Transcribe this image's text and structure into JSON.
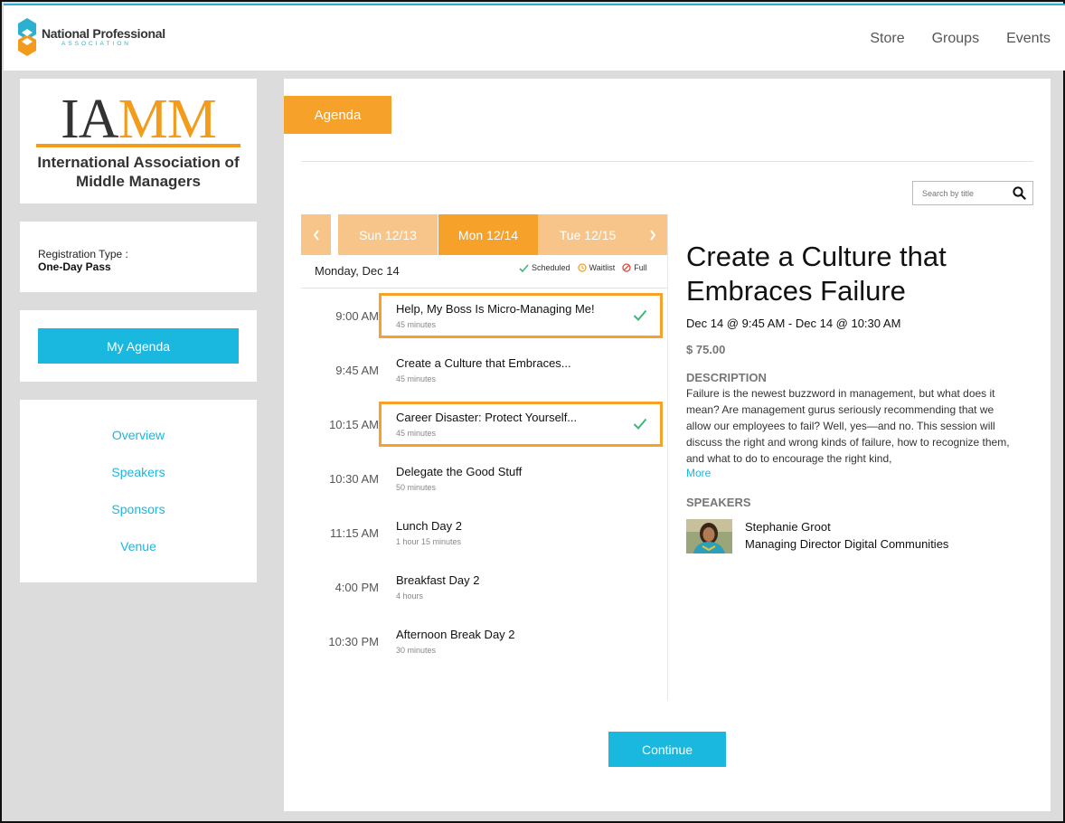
{
  "header": {
    "org_name": "National Professional",
    "org_sub": "ASSOCIATION",
    "nav": [
      {
        "label": "Store"
      },
      {
        "label": "Groups"
      },
      {
        "label": "Events"
      }
    ]
  },
  "sidebar": {
    "logo_word": "IAMM",
    "logo_name": "International Association of Middle Managers",
    "registration_label": "Registration Type :",
    "registration_value": "One-Day Pass",
    "my_agenda_button": "My Agenda",
    "links": [
      {
        "label": "Overview"
      },
      {
        "label": "Speakers"
      },
      {
        "label": "Sponsors"
      },
      {
        "label": "Venue"
      }
    ]
  },
  "main": {
    "tab_label": "Agenda",
    "search_placeholder": "Search by title",
    "days": [
      {
        "label": "Sun 12/13",
        "active": false
      },
      {
        "label": "Mon 12/14",
        "active": true
      },
      {
        "label": "Tue 12/15",
        "active": false
      }
    ],
    "day_heading": "Monday, Dec 14",
    "legend": {
      "scheduled": "Scheduled",
      "waitlist": "Waitlist",
      "full": "Full"
    },
    "sessions": [
      {
        "time": "9:00 AM",
        "title": "Help, My Boss Is Micro-Managing Me!",
        "duration": "45 minutes",
        "scheduled": true
      },
      {
        "time": "9:45 AM",
        "title": "Create a Culture that Embraces...",
        "duration": "45 minutes",
        "scheduled": false
      },
      {
        "time": "10:15 AM",
        "title": "Career Disaster: Protect Yourself...",
        "duration": "45 minutes",
        "scheduled": true
      },
      {
        "time": "10:30 AM",
        "title": "Delegate the Good Stuff",
        "duration": "50 minutes",
        "scheduled": false
      },
      {
        "time": "11:15 AM",
        "title": "Lunch Day 2",
        "duration": "1 hour 15 minutes",
        "scheduled": false
      },
      {
        "time": "4:00 PM",
        "title": "Breakfast Day 2",
        "duration": "4 hours",
        "scheduled": false
      },
      {
        "time": "10:30 PM",
        "title": "Afternoon Break Day 2",
        "duration": "30 minutes",
        "scheduled": false
      }
    ],
    "detail": {
      "title": "Create a Culture that Embraces Failure",
      "time": "Dec 14 @ 9:45 AM - Dec 14 @ 10:30 AM",
      "price": "$ 75.00",
      "description_label": "DESCRIPTION",
      "description": "Failure is the newest buzzword in management, but what does it mean? Are management gurus seriously recommending that we allow our employees to fail? Well, yes—and no. This session will discuss the right and wrong kinds of failure, how to recognize them, and what to do to encourage the right kind,",
      "more_label": "More",
      "speakers_label": "SPEAKERS",
      "speaker_name": "Stephanie Groot",
      "speaker_role": "Managing Director Digital Communities"
    },
    "continue_button": "Continue"
  },
  "colors": {
    "accent_orange": "#f5a12a",
    "light_orange": "#f7c58a",
    "accent_blue": "#1ab7de",
    "check_green": "#3cb878"
  }
}
